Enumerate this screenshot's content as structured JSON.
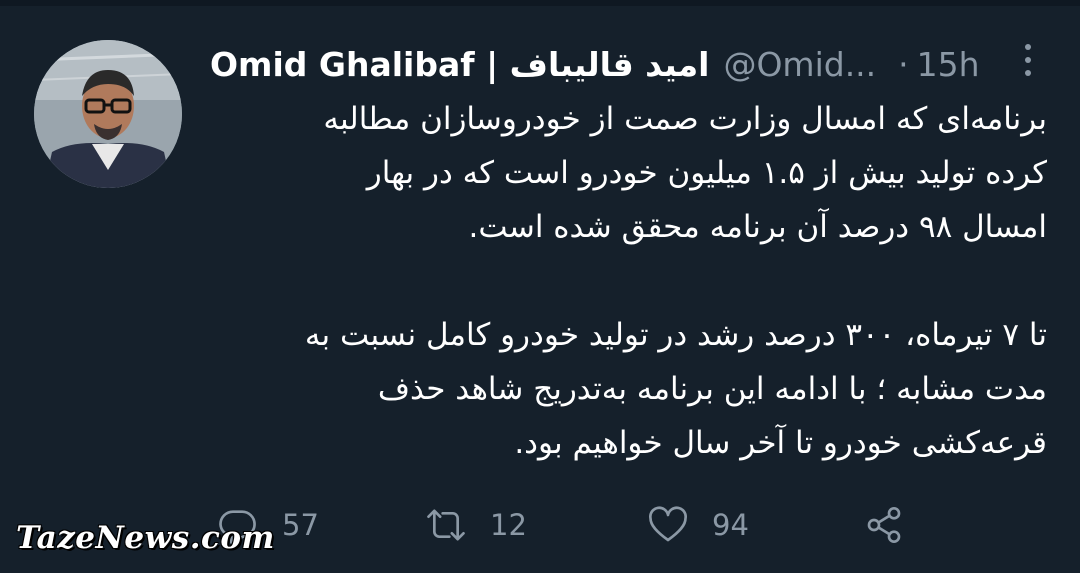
{
  "tweet": {
    "display_name": "Omid Ghalibaf | امید قالیباف",
    "handle": "@Omid...",
    "separator": "·",
    "time": "15h",
    "more_icon": "more-vertical-icon",
    "paragraphs": [
      [
        "برنامه‌ای که امسال وزارت صمت از خودروسازان مطالبه",
        "کرده تولید بیش از ۱.۵ میلیون خودرو است که در بهار",
        "امسال ۹۸ درصد آن برنامه محقق شده است."
      ],
      [
        "تا ۷ تیرماه، ۳۰۰ درصد رشد در تولید خودرو کامل نسبت به",
        "مدت مشابه ؛ با ادامه این برنامه به‌تدریج شاهد حذف",
        "قرعه‌کشی خودرو تا آخر سال خواهیم بود."
      ]
    ]
  },
  "actions": {
    "reply": {
      "icon": "reply-icon",
      "count": "57"
    },
    "retweet": {
      "icon": "retweet-icon",
      "count": "12"
    },
    "like": {
      "icon": "heart-icon",
      "count": "94"
    },
    "share": {
      "icon": "share-icon"
    }
  },
  "watermark": "TazeNews.com",
  "colors": {
    "background": "#15202b",
    "text": "#ffffff",
    "secondary": "#8b98a5"
  }
}
